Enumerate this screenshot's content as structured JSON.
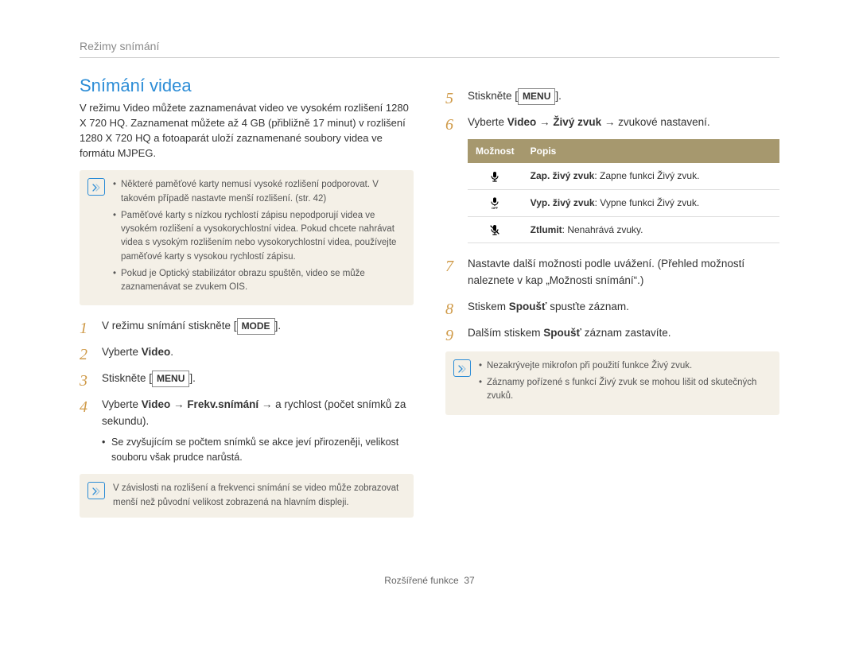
{
  "breadcrumb": "Režimy snímání",
  "title": "Snímání videa",
  "intro": "V režimu Video můžete zaznamenávat video ve vysokém rozlišení 1280 X 720 HQ. Zaznamenat můžete až 4 GB (přibližně 17 minut) v rozlišení 1280 X 720 HQ a fotoaparát uloží zaznamenané soubory videa ve formátu MJPEG.",
  "note1": {
    "items": [
      "Některé paměťové karty nemusí vysoké rozlišení podporovat. V takovém případě nastavte menší rozlišení. (str. 42)",
      "Paměťové karty s nízkou rychlostí zápisu nepodporují videa ve vysokém rozlišení a vysokorychlostní videa. Pokud chcete nahrávat videa s vysokým rozlišením nebo vysokorychlostní videa, používejte paměťové karty s vysokou rychlostí zápisu.",
      "Pokud je Optický stabilizátor obrazu spuštěn, video se může zaznamenávat se zvukem OIS."
    ]
  },
  "note2": {
    "text": "V závislosti na rozlišení a frekvenci snímání se video může zobrazovat menší než původní velikost zobrazená na hlavním displeji."
  },
  "note3": {
    "items": [
      "Nezakrývejte mikrofon při použití funkce Živý zvuk.",
      "Záznamy pořízené s funkcí Živý zvuk se mohou lišit od skutečných zvuků."
    ]
  },
  "steps_left": {
    "s1_pre": "V režimu snímání stiskněte [",
    "s1_key": "MODE",
    "s1_post": "].",
    "s2_pre": "Vyberte ",
    "s2_b": "Video",
    "s2_post": ".",
    "s3_pre": "Stiskněte [",
    "s3_key": "MENU",
    "s3_post": "].",
    "s4_pre": "Vyberte ",
    "s4_b1": "Video",
    "s4_arrow1": " → ",
    "s4_b2": "Frekv.snímání",
    "s4_arrow2": " → ",
    "s4_tail": "a rychlost (počet snímků za sekundu).",
    "s4_sub": "Se zvyšujícím se počtem snímků se akce jeví přirozeněji, velikost souboru však prudce narůstá."
  },
  "steps_right": {
    "s5_pre": "Stiskněte [",
    "s5_key": "MENU",
    "s5_post": "].",
    "s6_pre": "Vyberte ",
    "s6_b1": "Video",
    "s6_arrow1": " → ",
    "s6_b2": "Živý zvuk",
    "s6_arrow2": " → ",
    "s6_tail": "zvukové nastavení.",
    "s7": "Nastavte další možnosti podle uvážení. (Přehled možností naleznete v kap „Možnosti snímání“.)",
    "s8_pre": "Stiskem ",
    "s8_b": "Spoušť",
    "s8_post": " spusťte záznam.",
    "s9_pre": "Dalším stiskem ",
    "s9_b": "Spoušť",
    "s9_post": " záznam zastavíte."
  },
  "table": {
    "th1": "Možnost",
    "th2": "Popis",
    "rows": [
      {
        "icon": "mic-on",
        "label": "Zap. živý zvuk",
        "desc": ": Zapne funkci Živý zvuk."
      },
      {
        "icon": "mic-off",
        "label": "Vyp. živý zvuk",
        "desc": ": Vypne funkci Živý zvuk."
      },
      {
        "icon": "mic-mute",
        "label": "Ztlumit",
        "desc": ": Nenahrává zvuky."
      }
    ]
  },
  "footer_label": "Rozšířené funkce",
  "footer_page": "37"
}
